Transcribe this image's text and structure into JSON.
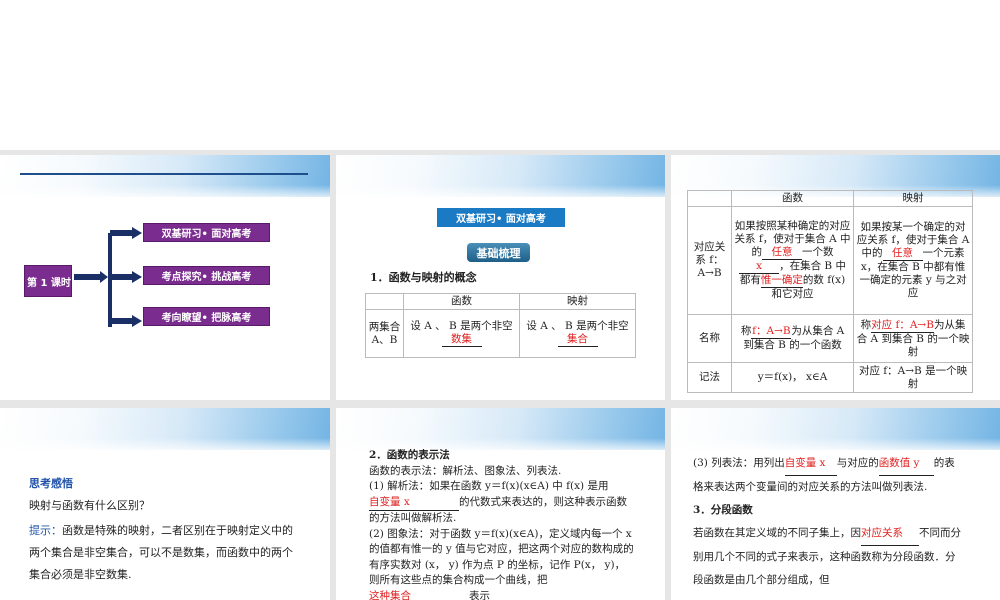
{
  "slide1": {
    "lesson": "第 1 课时",
    "items": [
      "双基研习• 面对高考",
      "考点探究• 挑战高考",
      "考向瞭望• 把脉高考"
    ]
  },
  "slide2": {
    "banner": "双基研习• 面对高考",
    "section": "基础梳理",
    "heading": "1．函数与映射的概念",
    "table": {
      "headers": [
        "",
        "函数",
        "映射"
      ],
      "row_label": "两集合 A、B",
      "func_text": "设 A 、 B 是两个非空",
      "func_answer": "数集",
      "map_text": "设 A 、 B 是两个非空",
      "map_answer": "集合"
    }
  },
  "slide3": {
    "headers": [
      "",
      "函数",
      "映射"
    ],
    "rows": [
      {
        "label": "对应关系 f：A→B",
        "func": "如果按照某种确定的对应关系 f，使对于集合 A 中的",
        "func_a1": "任意",
        "func_mid": "一个数",
        "func_a2": "x",
        "func_mid2": "，在集合 B 中都有",
        "func_a3": "惟一确定",
        "func_end": "的数 f(x) 和它对应",
        "map": "如果按某一个确定的对应关系 f，使对于集合 A 中的",
        "map_a1": "任意",
        "map_end": "一个元素 x，在集合 B 中都有惟一确定的元素 y 与之对应"
      },
      {
        "label": "名称",
        "func": "称",
        "func_a": "f：A→B",
        "func_end": "为从集合 A 到集合 B 的一个函数",
        "map": "称",
        "map_a": "对应 f：A→B",
        "map_end": "为从集合 A 到集合 B 的一个映射"
      },
      {
        "label": "记法",
        "func": "y＝f(x)， x∈A",
        "map": "对应 f：A→B 是一个映射"
      }
    ]
  },
  "slide4": {
    "title": "思考感悟",
    "question": "映射与函数有什么区别？",
    "hint_label": "提示：",
    "hint": "函数是特殊的映射，二者区别在于映射定义中的两个集合是非空集合，可以不是数集，而函数中的两个集合必须是非空数集."
  },
  "slide5": {
    "heading": "2．函数的表示法",
    "intro": "函数的表示法：解析法、图象法、列表法.",
    "p1a": "(1) 解析法：如果在函数 y＝f(x)(x∈A) 中 f(x) 是用",
    "p1_answer": "自变量 x",
    "p1b": "的代数式来表达的，则这种表示函数的方法叫做解析法.",
    "p2a": "(2) 图象法：对于函数 y＝f(x)(x∈A)，定义域内每一个 x 的值都有惟一的 y 值与它对应，把这两个对应的数构成的有序实数对 (x， y) 作为点 P 的坐标，记作 P(x， y)，则所有这些点的集合构成一个曲线，把",
    "p2_answer": "这种集合",
    "p2b": "表示"
  },
  "slide6": {
    "p3a": "(3) 列表法：用列出",
    "p3_answer1": "自变量 x",
    "p3b": "与对应的",
    "p3_answer2": "函数值 y",
    "p3c": "的表格来表达两个变量间的对应关系的方法叫做列表法.",
    "heading": "3．分段函数",
    "p4a": "若函数在其定义域的不同子集上，因",
    "p4_answer": "对应关系",
    "p4b": "不同而分别用几个不同的式子来表示，这种函数称为分段函数．分段函数是由几个部分组成，但"
  }
}
